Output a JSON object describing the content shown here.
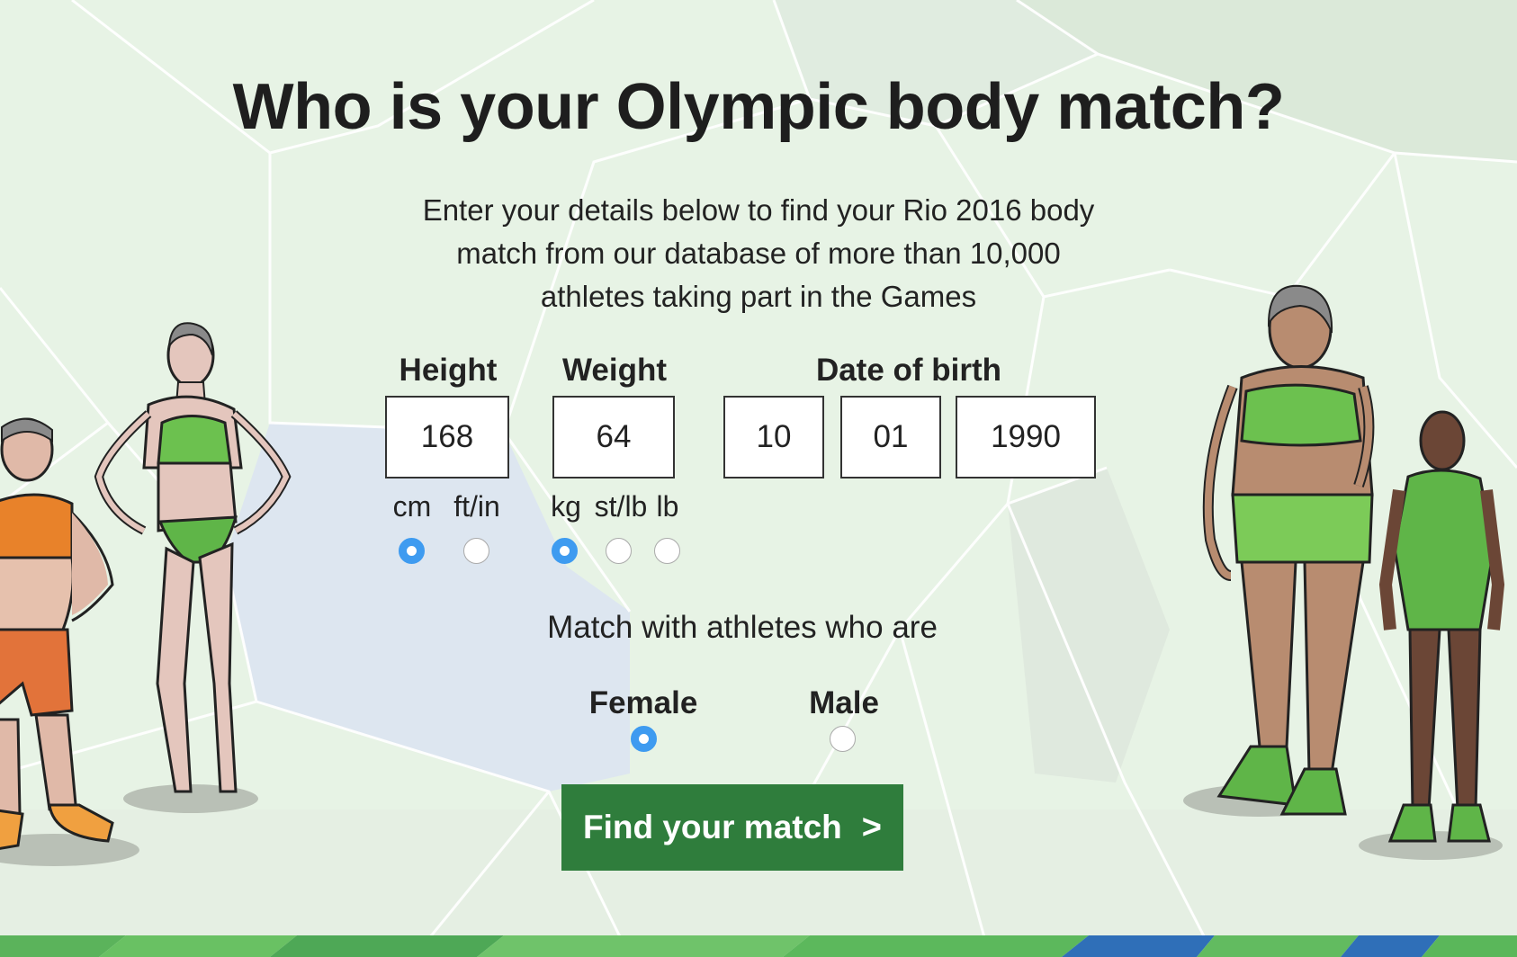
{
  "title": "Who is your Olympic body match?",
  "intro": {
    "line1": "Enter your details below to find your Rio 2016 body",
    "line2": "match from our database of more than 10,000",
    "line3": "athletes taking part in the Games"
  },
  "height": {
    "label": "Height",
    "value": "168",
    "units": [
      "cm",
      "ft/in"
    ],
    "selected_unit": "cm"
  },
  "weight": {
    "label": "Weight",
    "value": "64",
    "units": [
      "kg",
      "st/lb",
      "lb"
    ],
    "selected_unit": "kg"
  },
  "dob": {
    "label": "Date of birth",
    "day": "10",
    "month": "01",
    "year": "1990"
  },
  "match": {
    "prompt": "Match with athletes who are",
    "options": [
      "Female",
      "Male"
    ],
    "selected": "Female"
  },
  "submit": {
    "label": "Find your match",
    "icon": "chevron-right-icon"
  },
  "colors": {
    "accent": "#3e9bf0",
    "button": "#2f7d3c",
    "background": "#e7f3e5"
  }
}
